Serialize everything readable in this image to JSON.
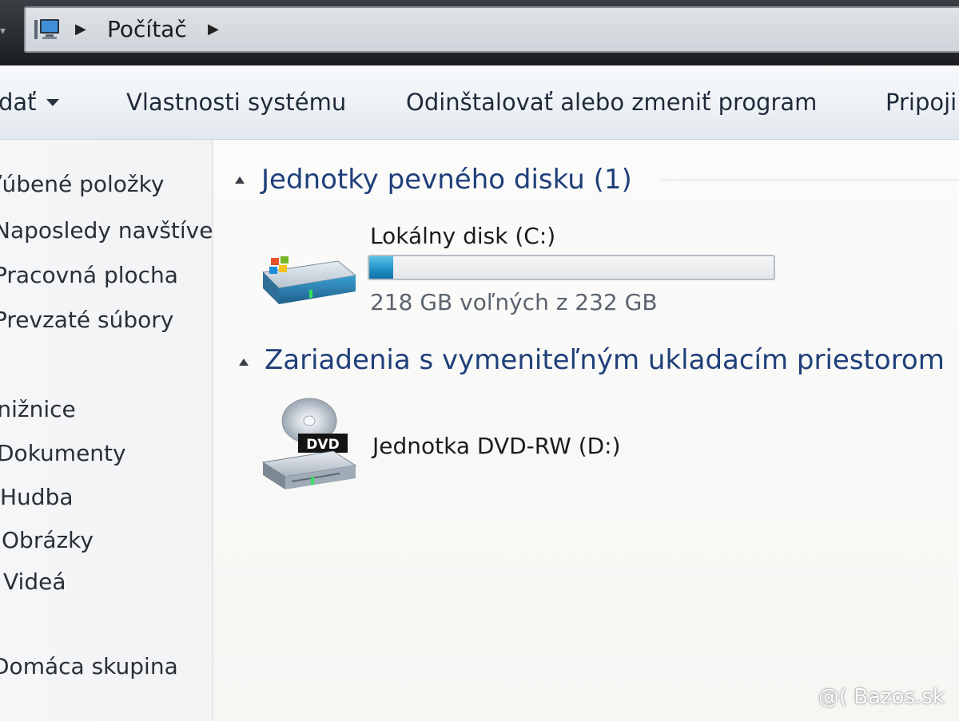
{
  "address_bar": {
    "crumbs": [
      "Počítač"
    ]
  },
  "toolbar": {
    "items": [
      "dať",
      "Vlastnosti systému",
      "Odinštalovať alebo zmeniť program",
      "Pripoji"
    ]
  },
  "sidebar": {
    "items": [
      "ľúbené položky",
      "Naposledy navštíver",
      "Pracovná plocha",
      "Prevzaté súbory",
      "Knižnice",
      "Dokumenty",
      "Hudba",
      "Obrázky",
      "Videá",
      "Domáca skupina"
    ]
  },
  "content": {
    "groups": [
      {
        "title": "Jednotky pevného disku (1)",
        "drives": [
          {
            "name": "Lokálny disk (C:)",
            "space_text": "218 GB voľných z 232 GB",
            "used_fraction": 0.06
          }
        ]
      },
      {
        "title": "Zariadenia s vymeniteľným ukladacím priestorom",
        "drives": [
          {
            "name": "Jednotka DVD-RW (D:)",
            "icon_label": "DVD"
          }
        ]
      }
    ]
  },
  "watermark": "@( Bazos.sk",
  "icons": {
    "computer": "computer-icon",
    "hdd": "hard-drive-icon",
    "dvd": "dvd-drive-icon"
  },
  "colors": {
    "group_header": "#1f3f7a",
    "usage_bar": "#1f8fc5"
  }
}
